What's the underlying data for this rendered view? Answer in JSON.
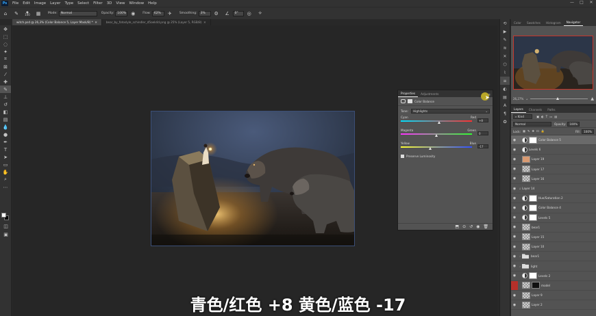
{
  "menubar": {
    "app_icon": "Ps",
    "items": [
      "File",
      "Edit",
      "Image",
      "Layer",
      "Type",
      "Select",
      "Filter",
      "3D",
      "View",
      "Window",
      "Help"
    ],
    "window_controls": [
      "—",
      "□",
      "✕"
    ]
  },
  "options": {
    "brush_size": "100",
    "mode_label": "Mode:",
    "mode_value": "Normal",
    "opacity_label": "Opacity:",
    "opacity_value": "100%",
    "flow_label": "Flow:",
    "flow_value": "62%",
    "smoothing_label": "Smoothing:",
    "smoothing_value": "3%",
    "angle_value": "0°"
  },
  "tabs": [
    {
      "label": "witch.psd @ 26,3% (Color Balance 5, Layer Mask/8) *"
    },
    {
      "label": "bear_by_fotoslyle_schindler_d5oek4d.png @ 25% (Layer 5, RGB/8)"
    }
  ],
  "properties": {
    "tab_properties": "Properties",
    "tab_adjustments": "Adjustments",
    "adjustment_name": "Color Balance",
    "tone_label": "Tone:",
    "tone_value": "Highlights",
    "cyan_label": "Cyan",
    "red_label": "Red",
    "cyan_red_value": "+8",
    "cyan_red_level": 8,
    "magenta_label": "Magenta",
    "green_label": "Green",
    "magenta_green_value": "0",
    "magenta_green_level": 0,
    "yellow_label": "Yellow",
    "blue_label": "Blue",
    "yellow_blue_value": "-17",
    "yellow_blue_level": -17,
    "preserve_label": "Preserve Luminosity"
  },
  "navigator": {
    "tabs": [
      "Color",
      "Swatches",
      "Histogram",
      "Navigator"
    ],
    "zoom": "26,27%"
  },
  "layers": {
    "tabs": [
      "Layers",
      "Channels",
      "Paths"
    ],
    "kind_label": "Kind",
    "blend_mode": "Normal",
    "opacity_label": "Opacity:",
    "opacity_value": "100%",
    "lock_label": "Lock:",
    "fill_label": "Fill:",
    "fill_value": "100%",
    "rows": [
      {
        "name": "Color Balance 5",
        "type": "adj-mask",
        "selected": true
      },
      {
        "name": "Levels 6",
        "type": "adj"
      },
      {
        "name": "Layer 19",
        "type": "peach"
      },
      {
        "name": "Layer 17",
        "type": "checker"
      },
      {
        "name": "Layer 16",
        "type": "checker"
      },
      {
        "name": "Layer 14",
        "type": "plain"
      },
      {
        "name": "Hue/Saturation 2",
        "type": "adj-mask"
      },
      {
        "name": "Color Balance 4",
        "type": "adj-mask"
      },
      {
        "name": "Levels 5",
        "type": "adj-mask"
      },
      {
        "name": "bear1",
        "type": "checker"
      },
      {
        "name": "Layer 15",
        "type": "checker"
      },
      {
        "name": "Layer 10",
        "type": "checker"
      },
      {
        "name": "bear1",
        "type": "folder"
      },
      {
        "name": "light",
        "type": "folder"
      },
      {
        "name": "Levels 2",
        "type": "adj-mask"
      },
      {
        "name": "model",
        "type": "dark-mask",
        "eye_off": true
      },
      {
        "name": "Layer 9",
        "type": "checker"
      },
      {
        "name": "Layer 2",
        "type": "checker"
      }
    ]
  },
  "subtitle": "青色/红色 +8 黄色/蓝色 -17",
  "colors": {
    "accent": "#31a8ff",
    "panel": "#535353",
    "chrome": "#323232",
    "canvas": "#262626",
    "navigator_frame": "#c8352a"
  }
}
